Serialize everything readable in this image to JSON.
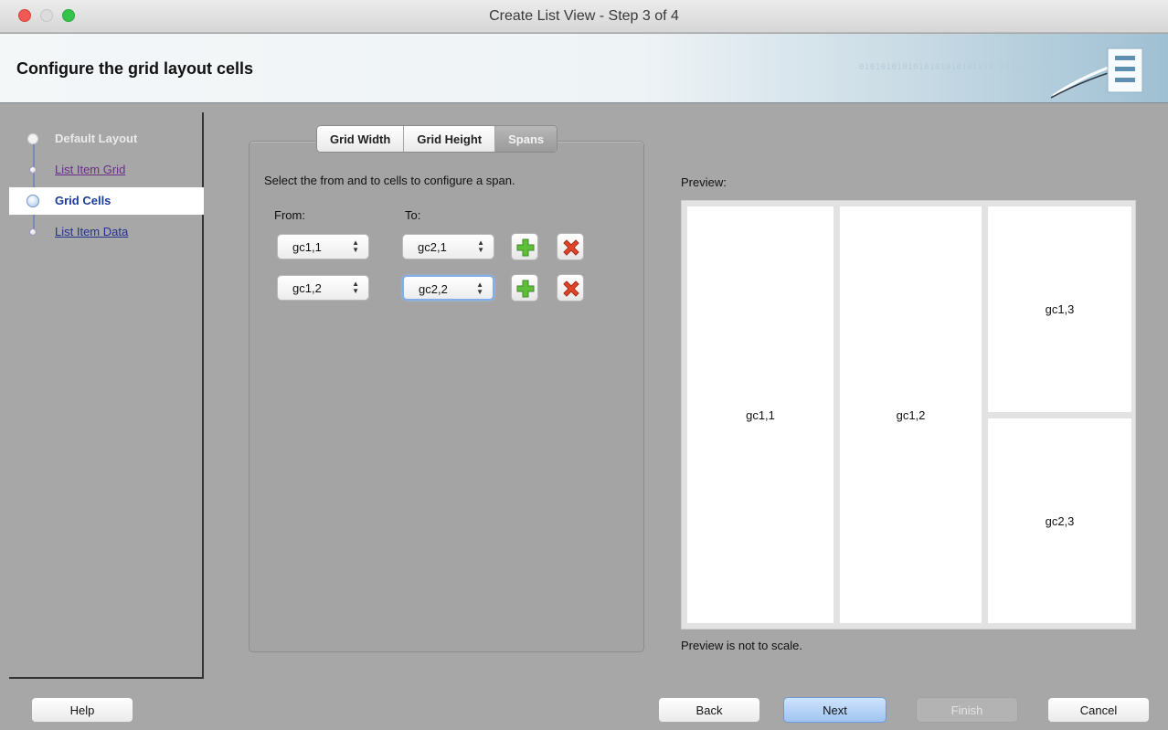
{
  "window": {
    "title": "Create List View - Step 3 of 4"
  },
  "header": {
    "title": "Configure the grid layout cells",
    "binary_text": "0101010101010101010101010 01010101010"
  },
  "nav": {
    "items": [
      {
        "label": "Default Layout",
        "state": "default"
      },
      {
        "label": "List Item Grid",
        "state": "visited"
      },
      {
        "label": "Grid Cells",
        "state": "current"
      },
      {
        "label": "List Item Data",
        "state": "link"
      }
    ]
  },
  "tabs": [
    {
      "label": "Grid Width",
      "active": false
    },
    {
      "label": "Grid Height",
      "active": false
    },
    {
      "label": "Spans",
      "active": true
    }
  ],
  "spans": {
    "instruction": "Select the from and to cells to configure a span.",
    "from_label": "From:",
    "to_label": "To:",
    "rows": [
      {
        "from": "gc1,1",
        "to": "gc2,1"
      },
      {
        "from": "gc1,2",
        "to": "gc2,2"
      }
    ]
  },
  "preview": {
    "label": "Preview:",
    "note": "Preview is not to scale.",
    "cells": [
      "gc1,1",
      "gc1,2",
      "gc1,3",
      "gc2,3"
    ]
  },
  "buttons": {
    "help": "Help",
    "back": "Back",
    "next": "Next",
    "finish": "Finish",
    "cancel": "Cancel"
  },
  "colors": {
    "background": "#a7a7a7",
    "accent": "#9ec4f1",
    "add_icon": "#5fbf3a",
    "remove_icon": "#e0452a"
  },
  "icons": [
    "add-icon",
    "remove-icon",
    "select-arrows-icon",
    "wizard-step-icon"
  ]
}
